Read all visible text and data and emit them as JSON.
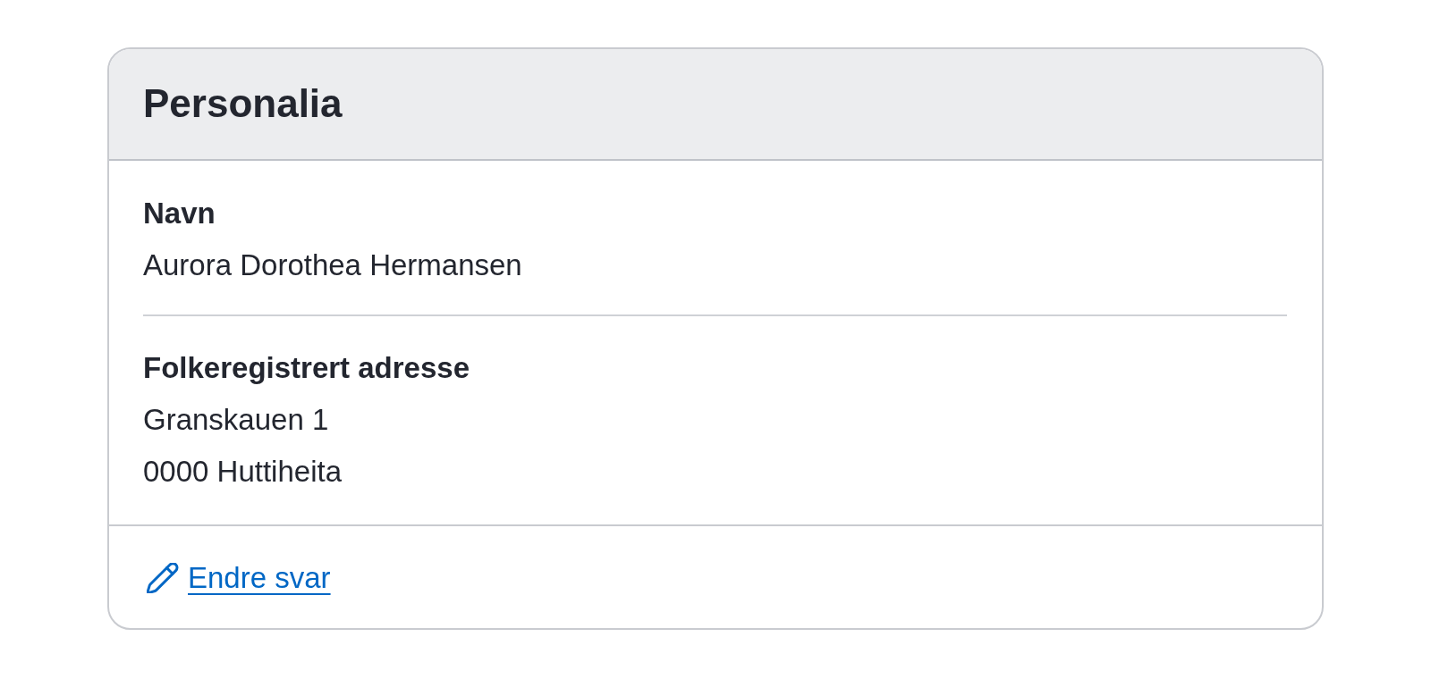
{
  "card": {
    "title": "Personalia",
    "sections": [
      {
        "label": "Navn",
        "lines": [
          "Aurora Dorothea Hermansen"
        ]
      },
      {
        "label": "Folkeregistrert adresse",
        "lines": [
          "Granskauen 1",
          "0000 Huttiheita"
        ]
      }
    ],
    "footer_link": {
      "label": "Endre svar"
    }
  }
}
